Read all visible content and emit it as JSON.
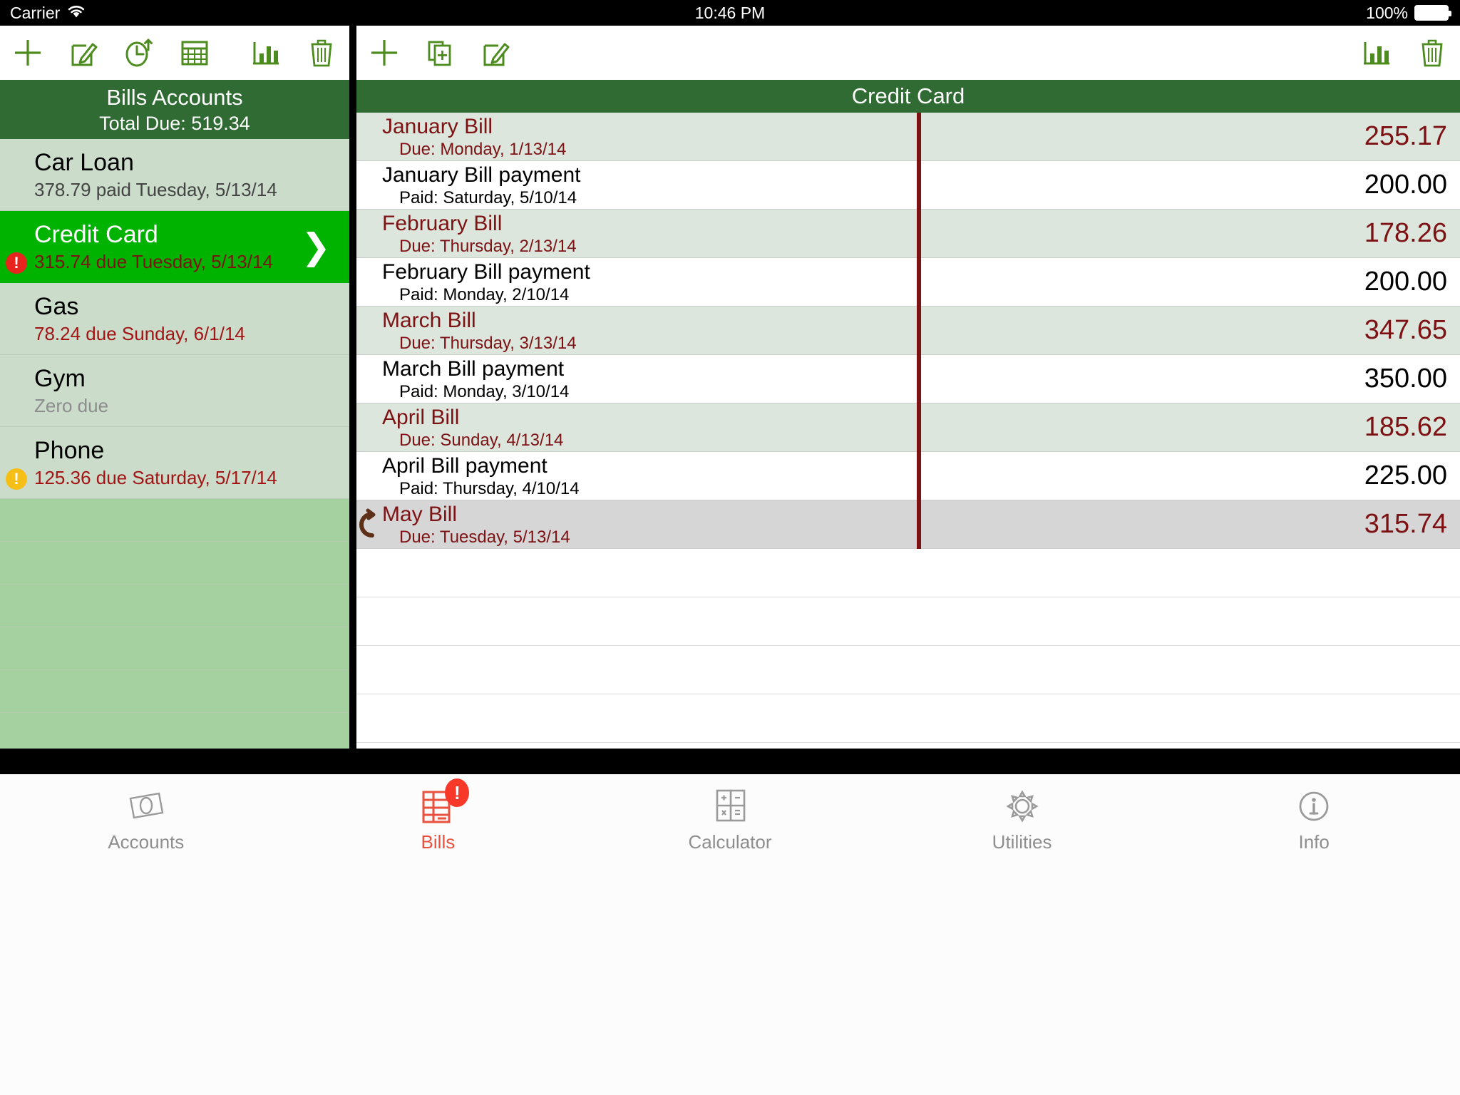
{
  "status_bar": {
    "carrier": "Carrier",
    "wifi_icon": "wifi-icon",
    "time": "10:46 PM",
    "battery_percent": "100%"
  },
  "left_toolbar": {
    "buttons": [
      {
        "name": "add-icon",
        "label": "Add"
      },
      {
        "name": "edit-icon",
        "label": "Edit"
      },
      {
        "name": "history-icon",
        "label": "History"
      },
      {
        "name": "calendar-icon",
        "label": "Calendar"
      },
      {
        "name": "chart-icon",
        "label": "Charts"
      },
      {
        "name": "trash-icon",
        "label": "Delete"
      }
    ]
  },
  "right_toolbar": {
    "buttons": [
      {
        "name": "add-icon",
        "label": "Add"
      },
      {
        "name": "duplicate-icon",
        "label": "Duplicate"
      },
      {
        "name": "edit-icon",
        "label": "Edit"
      },
      {
        "name": "chart-icon",
        "label": "Charts"
      },
      {
        "name": "trash-icon",
        "label": "Delete"
      }
    ]
  },
  "accounts_panel": {
    "header_title": "Bills Accounts",
    "header_subtitle": "Total Due: 519.34",
    "items": [
      {
        "name": "Car Loan",
        "detail": "378.79 paid Tuesday, 5/13/14",
        "state": "paid",
        "badge": "none",
        "selected": false
      },
      {
        "name": "Credit Card",
        "detail": "315.74 due Tuesday, 5/13/14",
        "state": "overdue",
        "badge": "red",
        "selected": true
      },
      {
        "name": "Gas",
        "detail": "78.24 due Sunday, 6/1/14",
        "state": "due",
        "badge": "none",
        "selected": false
      },
      {
        "name": "Gym",
        "detail": "Zero due",
        "state": "zero",
        "badge": "none",
        "selected": false
      },
      {
        "name": "Phone",
        "detail": "125.36 due Saturday, 5/17/14",
        "state": "due",
        "badge": "amber",
        "selected": false
      }
    ]
  },
  "bills_panel": {
    "header_title": "Credit Card",
    "rows": [
      {
        "title": "January Bill",
        "sub": "Due: Monday, 1/13/14",
        "amount": "255.17",
        "kind": "bill",
        "recurring": false
      },
      {
        "title": "January Bill payment",
        "sub": "Paid: Saturday, 5/10/14",
        "amount": "200.00",
        "kind": "payment",
        "recurring": false
      },
      {
        "title": "February Bill",
        "sub": "Due: Thursday, 2/13/14",
        "amount": "178.26",
        "kind": "bill",
        "recurring": false
      },
      {
        "title": "February Bill payment",
        "sub": "Paid: Monday, 2/10/14",
        "amount": "200.00",
        "kind": "payment",
        "recurring": false
      },
      {
        "title": "March Bill",
        "sub": "Due: Thursday, 3/13/14",
        "amount": "347.65",
        "kind": "bill",
        "recurring": false
      },
      {
        "title": "March Bill payment",
        "sub": "Paid: Monday, 3/10/14",
        "amount": "350.00",
        "kind": "payment",
        "recurring": false
      },
      {
        "title": "April Bill",
        "sub": "Due: Sunday, 4/13/14",
        "amount": "185.62",
        "kind": "bill",
        "recurring": false
      },
      {
        "title": "April Bill payment",
        "sub": "Paid: Thursday, 4/10/14",
        "amount": "225.00",
        "kind": "payment",
        "recurring": false
      },
      {
        "title": "May Bill",
        "sub": "Due: Tuesday, 5/13/14",
        "amount": "315.74",
        "kind": "current",
        "recurring": true
      }
    ]
  },
  "tab_bar": {
    "items": [
      {
        "label": "Accounts",
        "icon": "money-icon",
        "active": false,
        "badge": ""
      },
      {
        "label": "Bills",
        "icon": "bill-list-icon",
        "active": true,
        "badge": "!"
      },
      {
        "label": "Calculator",
        "icon": "calculator-icon",
        "active": false,
        "badge": ""
      },
      {
        "label": "Utilities",
        "icon": "gear-icon",
        "active": false,
        "badge": ""
      },
      {
        "label": "Info",
        "icon": "info-icon",
        "active": false,
        "badge": ""
      }
    ]
  },
  "colors": {
    "brand_green": "#2f6b33",
    "selection_green": "#00b300",
    "toolbar_green": "#4c8c1e",
    "due_red": "#a31515",
    "bill_red": "#7d1214",
    "badge_red": "#e8241e",
    "badge_amber": "#f5bf18",
    "tab_active": "#e8523f"
  }
}
